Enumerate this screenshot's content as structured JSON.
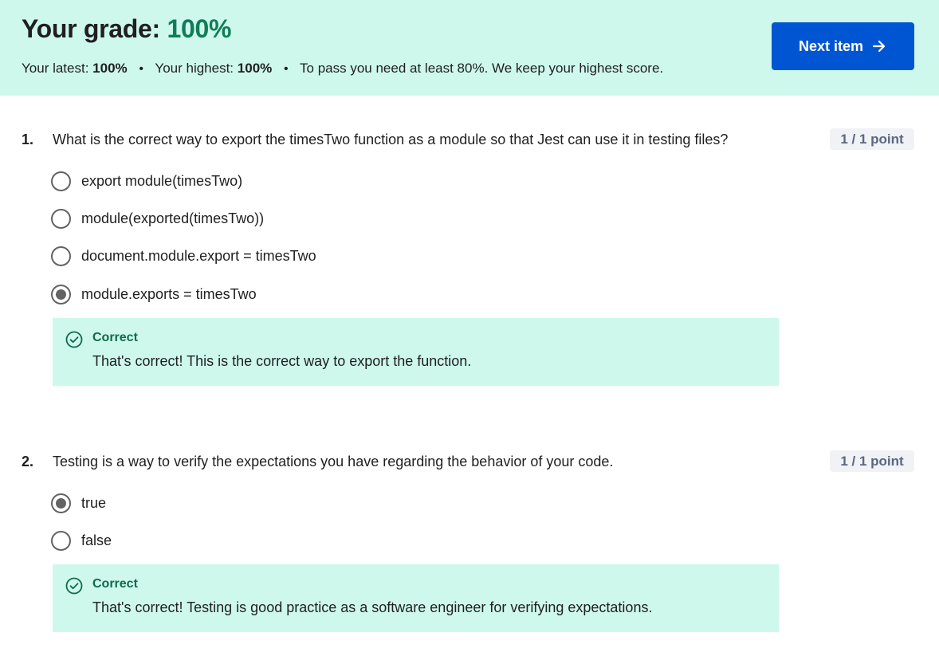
{
  "header": {
    "grade_label": "Your grade:",
    "grade_value": "100%",
    "latest_label": "Your latest:",
    "latest_value": "100%",
    "highest_label": "Your highest:",
    "highest_value": "100%",
    "separator": "•",
    "pass_note": "To pass you need at least 80%. We keep your highest score.",
    "next_button_label": "Next item",
    "next_button_icon": "arrow-right-icon"
  },
  "colors": {
    "banner_bg": "#cef8ec",
    "grade_accent": "#0f7d55",
    "button_bg": "#0056d2",
    "feedback_title": "#0f6b4a",
    "points_badge_bg": "#f0f2f6"
  },
  "questions": [
    {
      "number": "1.",
      "text": "What is the correct way to export the  timesTwo  function as a module so that Jest can use it in testing files?",
      "points": "1 / 1 point",
      "options": [
        {
          "label": "export module(timesTwo)",
          "selected": false
        },
        {
          "label": "module(exported(timesTwo))",
          "selected": false
        },
        {
          "label": "document.module.export = timesTwo",
          "selected": false
        },
        {
          "label": "module.exports = timesTwo",
          "selected": true
        }
      ],
      "feedback": {
        "icon": "check-circle-icon",
        "title": "Correct",
        "text": "That's correct! This is the correct way to export the function."
      }
    },
    {
      "number": "2.",
      "text": "Testing is a way to verify the expectations you have regarding the behavior of your code.",
      "points": "1 / 1 point",
      "options": [
        {
          "label": "true",
          "selected": true
        },
        {
          "label": "false",
          "selected": false
        }
      ],
      "feedback": {
        "icon": "check-circle-icon",
        "title": "Correct",
        "text": "That's correct! Testing is good practice as a software engineer for verifying expectations."
      }
    }
  ]
}
